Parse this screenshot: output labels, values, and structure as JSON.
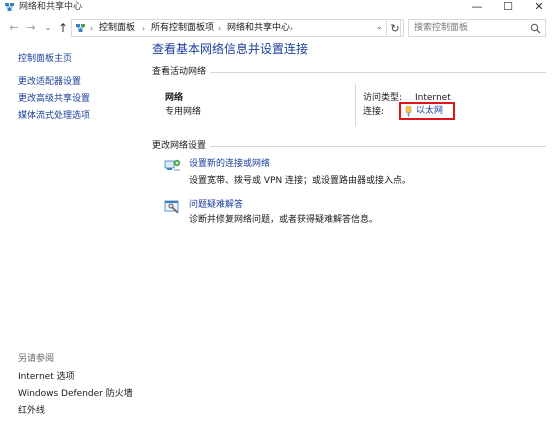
{
  "window": {
    "title": "网络和共享中心",
    "minimize": "—",
    "maximize": "☐",
    "close": "✕"
  },
  "nav": {
    "back": "←",
    "forward": "→",
    "recent": "⌄",
    "up": "↑",
    "breadcrumbs": [
      "控制面板",
      "所有控制面板项",
      "网络和共享中心"
    ],
    "separator": "›",
    "dropdown": "⌄",
    "refresh": "↻",
    "search_placeholder": "搜索控制面板"
  },
  "sidebar": {
    "home": "控制面板主页",
    "links": [
      "更改适配器设置",
      "更改高级共享设置",
      "媒体流式处理选项"
    ],
    "see_also_title": "另请参阅",
    "see_also": [
      "Internet 选项",
      "Windows Defender 防火墙",
      "红外线"
    ]
  },
  "main": {
    "title": "查看基本网络信息并设置连接",
    "active_networks_header": "查看活动网络",
    "network": {
      "name": "网络",
      "type": "专用网络",
      "access_type_label": "访问类型:",
      "access_type_value": "Internet",
      "connections_label": "连接:",
      "connection_name": "以太网"
    },
    "change_settings_header": "更改网络设置",
    "tasks": [
      {
        "link": "设置新的连接或网络",
        "desc": "设置宽带、拨号或 VPN 连接；或设置路由器或接入点。",
        "icon": "new-connection-icon"
      },
      {
        "link": "问题疑难解答",
        "desc": "诊断并修复网络问题，或者获得疑难解答信息。",
        "icon": "troubleshoot-icon"
      }
    ]
  },
  "colors": {
    "link": "#1a3e9c",
    "highlight_box": "#e0141c",
    "divider": "#d6d6d6"
  }
}
